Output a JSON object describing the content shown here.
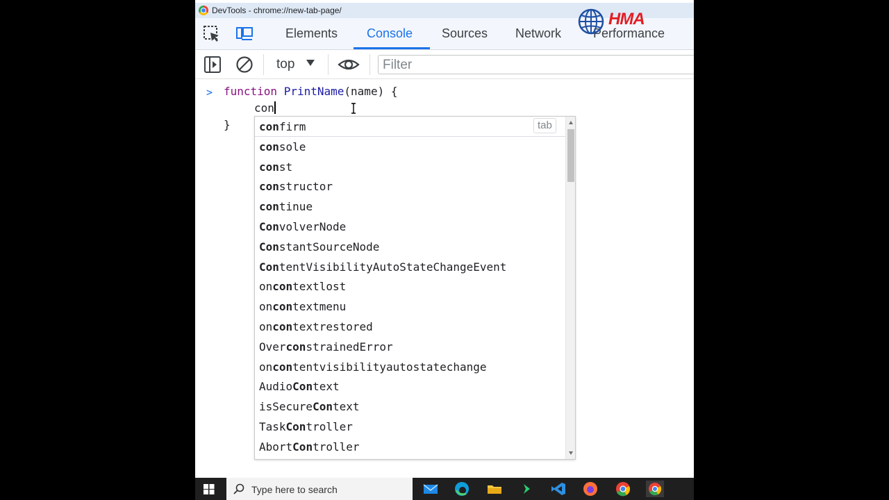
{
  "window": {
    "title": "DevTools - chrome://new-tab-page/"
  },
  "tabs": [
    "Elements",
    "Console",
    "Sources",
    "Network",
    "Performance"
  ],
  "logo": {
    "text": "HMA"
  },
  "toolbar": {
    "context": "top",
    "filter_placeholder": "Filter"
  },
  "console": {
    "prompt": ">",
    "code": {
      "keyword": "function",
      "fn_name": "PrintName",
      "params": "(name) {",
      "typed": "con",
      "close": "}"
    }
  },
  "autocomplete": {
    "tab_hint": "tab",
    "items": [
      {
        "pre": "",
        "match": "con",
        "post": "firm"
      },
      {
        "pre": "",
        "match": "con",
        "post": "sole"
      },
      {
        "pre": "",
        "match": "con",
        "post": "st"
      },
      {
        "pre": "",
        "match": "con",
        "post": "structor"
      },
      {
        "pre": "",
        "match": "con",
        "post": "tinue"
      },
      {
        "pre": "",
        "match": "Con",
        "post": "volverNode"
      },
      {
        "pre": "",
        "match": "Con",
        "post": "stantSourceNode"
      },
      {
        "pre": "",
        "match": "Con",
        "post": "tentVisibilityAutoStateChangeEvent"
      },
      {
        "pre": "on",
        "match": "con",
        "post": "textlost"
      },
      {
        "pre": "on",
        "match": "con",
        "post": "textmenu"
      },
      {
        "pre": "on",
        "match": "con",
        "post": "textrestored"
      },
      {
        "pre": "Over",
        "match": "con",
        "post": "strainedError"
      },
      {
        "pre": "on",
        "match": "con",
        "post": "tentvisibilityautostatechange"
      },
      {
        "pre": "Audio",
        "match": "Con",
        "post": "text"
      },
      {
        "pre": "isSecure",
        "match": "Con",
        "post": "text"
      },
      {
        "pre": "Task",
        "match": "Con",
        "post": "troller"
      },
      {
        "pre": "Abort",
        "match": "Con",
        "post": "troller"
      }
    ]
  },
  "taskbar": {
    "search_placeholder": "Type here to search"
  }
}
